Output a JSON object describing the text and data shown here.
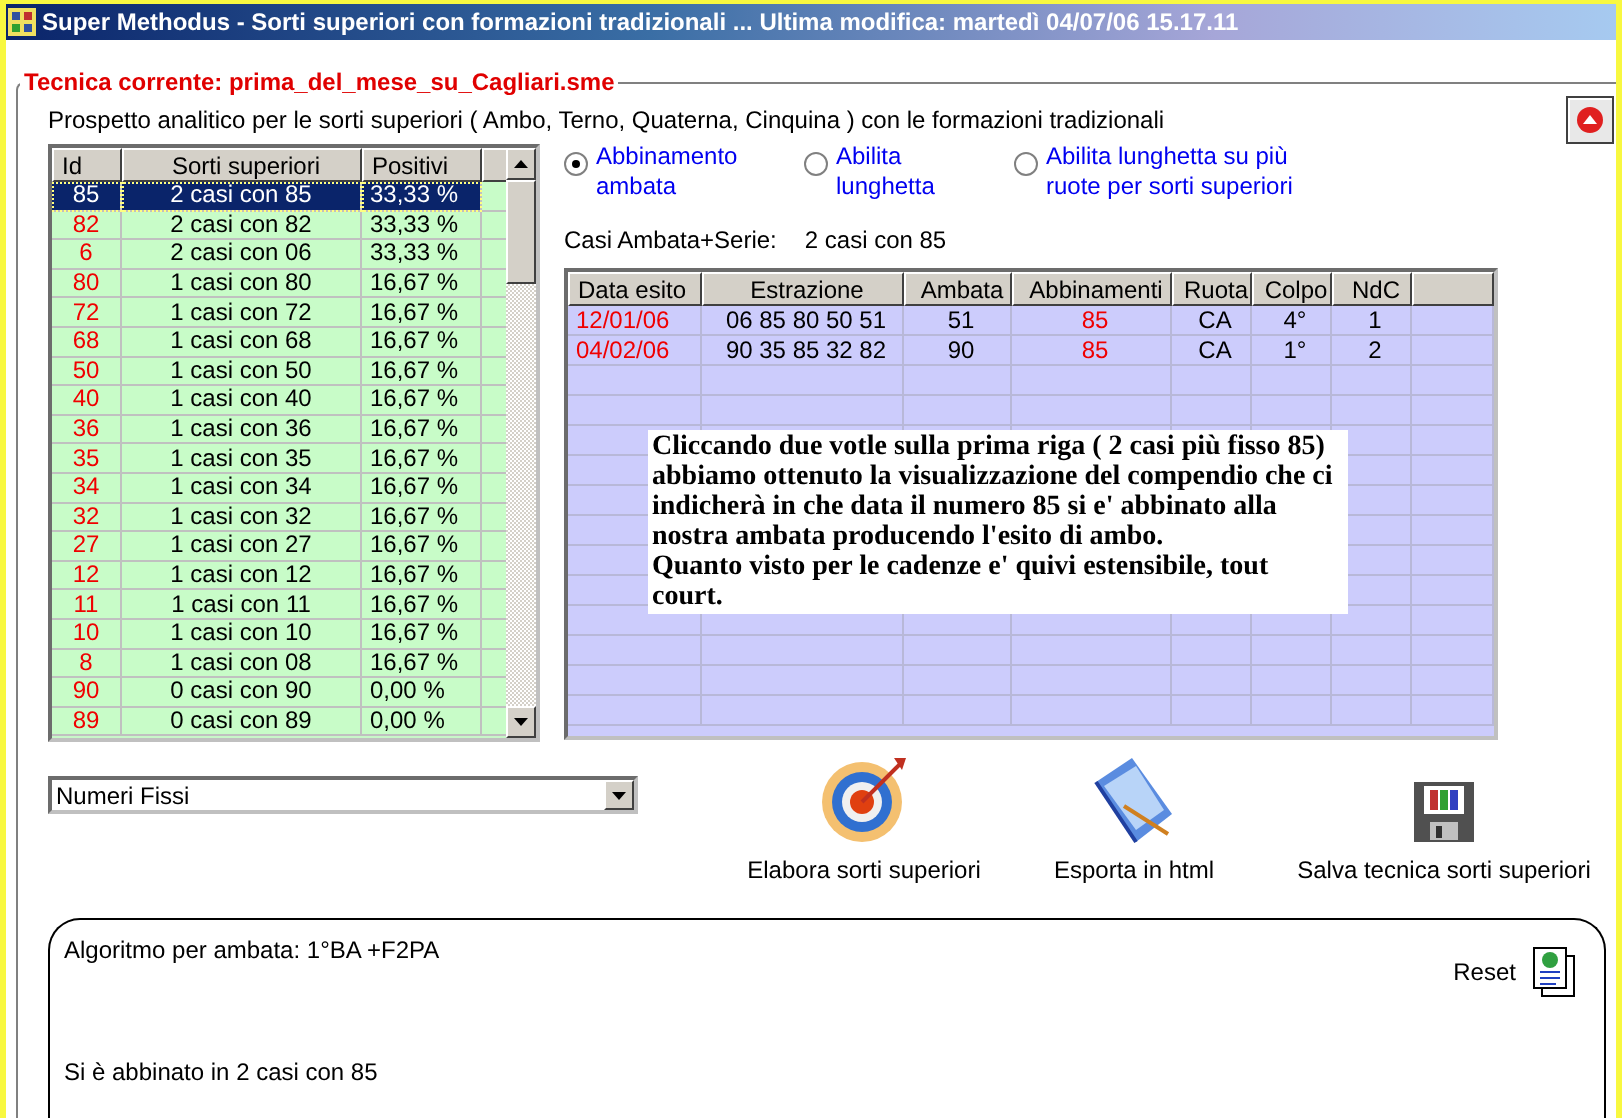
{
  "window": {
    "title": "Super Methodus - Sorti superiori con formazioni tradizionali ... Ultima modifica: martedì 04/07/06 15.17.11"
  },
  "technique": {
    "legend": "Tecnica corrente: prima_del_mese_su_Cagliari.sme"
  },
  "subtitle": "Prospetto analitico per le sorti superiori ( Ambo, Terno, Quaterna, Cinquina ) con le formazioni tradizionali",
  "left_table": {
    "columns": [
      "Id",
      "Sorti superiori",
      "Positivi"
    ],
    "rows": [
      {
        "id": "85",
        "sorte": "2 casi con 85",
        "positivi": "33,33 %",
        "selected": true
      },
      {
        "id": "82",
        "sorte": "2 casi con 82",
        "positivi": "33,33 %",
        "selected": false
      },
      {
        "id": "6",
        "sorte": "2 casi con 06",
        "positivi": "33,33 %",
        "selected": false
      },
      {
        "id": "80",
        "sorte": "1 casi con 80",
        "positivi": "16,67 %",
        "selected": false
      },
      {
        "id": "72",
        "sorte": "1 casi con 72",
        "positivi": "16,67 %",
        "selected": false
      },
      {
        "id": "68",
        "sorte": "1 casi con 68",
        "positivi": "16,67 %",
        "selected": false
      },
      {
        "id": "50",
        "sorte": "1 casi con 50",
        "positivi": "16,67 %",
        "selected": false
      },
      {
        "id": "40",
        "sorte": "1 casi con 40",
        "positivi": "16,67 %",
        "selected": false
      },
      {
        "id": "36",
        "sorte": "1 casi con 36",
        "positivi": "16,67 %",
        "selected": false
      },
      {
        "id": "35",
        "sorte": "1 casi con 35",
        "positivi": "16,67 %",
        "selected": false
      },
      {
        "id": "34",
        "sorte": "1 casi con 34",
        "positivi": "16,67 %",
        "selected": false
      },
      {
        "id": "32",
        "sorte": "1 casi con 32",
        "positivi": "16,67 %",
        "selected": false
      },
      {
        "id": "27",
        "sorte": "1 casi con 27",
        "positivi": "16,67 %",
        "selected": false
      },
      {
        "id": "12",
        "sorte": "1 casi con 12",
        "positivi": "16,67 %",
        "selected": false
      },
      {
        "id": "11",
        "sorte": "1 casi con 11",
        "positivi": "16,67 %",
        "selected": false
      },
      {
        "id": "10",
        "sorte": "1 casi con 10",
        "positivi": "16,67 %",
        "selected": false
      },
      {
        "id": "8",
        "sorte": "1 casi con 08",
        "positivi": "16,67 %",
        "selected": false
      },
      {
        "id": "90",
        "sorte": "0 casi con 90",
        "positivi": "0,00 %",
        "selected": false
      },
      {
        "id": "89",
        "sorte": "0 casi con 89",
        "positivi": "0,00 %",
        "selected": false
      }
    ]
  },
  "options": [
    {
      "label": "Abbinamento ambata",
      "selected": true
    },
    {
      "label": "Abilita lunghetta",
      "selected": false
    },
    {
      "label": "Abilita lunghetta su più ruote per sorti superiori",
      "selected": false
    }
  ],
  "cases": {
    "label": "Casi Ambata+Serie:",
    "value": "2 casi con 85"
  },
  "right_table": {
    "columns": [
      "Data esito",
      "Estrazione",
      "Ambata",
      "Abbinamenti",
      "Ruota",
      "Colpo",
      "NdC"
    ],
    "rows": [
      {
        "data": "12/01/06",
        "estrazione": "06 85 80 50 51",
        "ambata": "51",
        "abbinamenti": "85",
        "ruota": "CA",
        "colpo": "4°",
        "ndc": "1"
      },
      {
        "data": "04/02/06",
        "estrazione": "90 35 85 32 82",
        "ambata": "90",
        "abbinamenti": "85",
        "ruota": "CA",
        "colpo": "1°",
        "ndc": "2"
      }
    ]
  },
  "note": {
    "paragraphs": [
      "Cliccando due votle sulla prima riga ( 2 casi più fisso 85) abbiamo ottenuto la visualizzazione del compendio che ci indicherà in che data il numero 85 si e' abbinato alla nostra ambata producendo l'esito di ambo.",
      "Quanto visto per le cadenze e' quivi estensibile, tout court."
    ]
  },
  "dropdown": {
    "value": "Numeri Fissi"
  },
  "actions": [
    {
      "kind": "target",
      "label": "Elabora sorti superiori"
    },
    {
      "kind": "book",
      "label": "Esporta in html"
    },
    {
      "kind": "floppy",
      "label": "Salva tecnica sorti superiori"
    }
  ],
  "result_panel": {
    "algorithm": "Algoritmo per ambata: 1°BA +F2PA",
    "reset": "Reset",
    "result": "Si è abbinato in 2 casi con 85"
  }
}
